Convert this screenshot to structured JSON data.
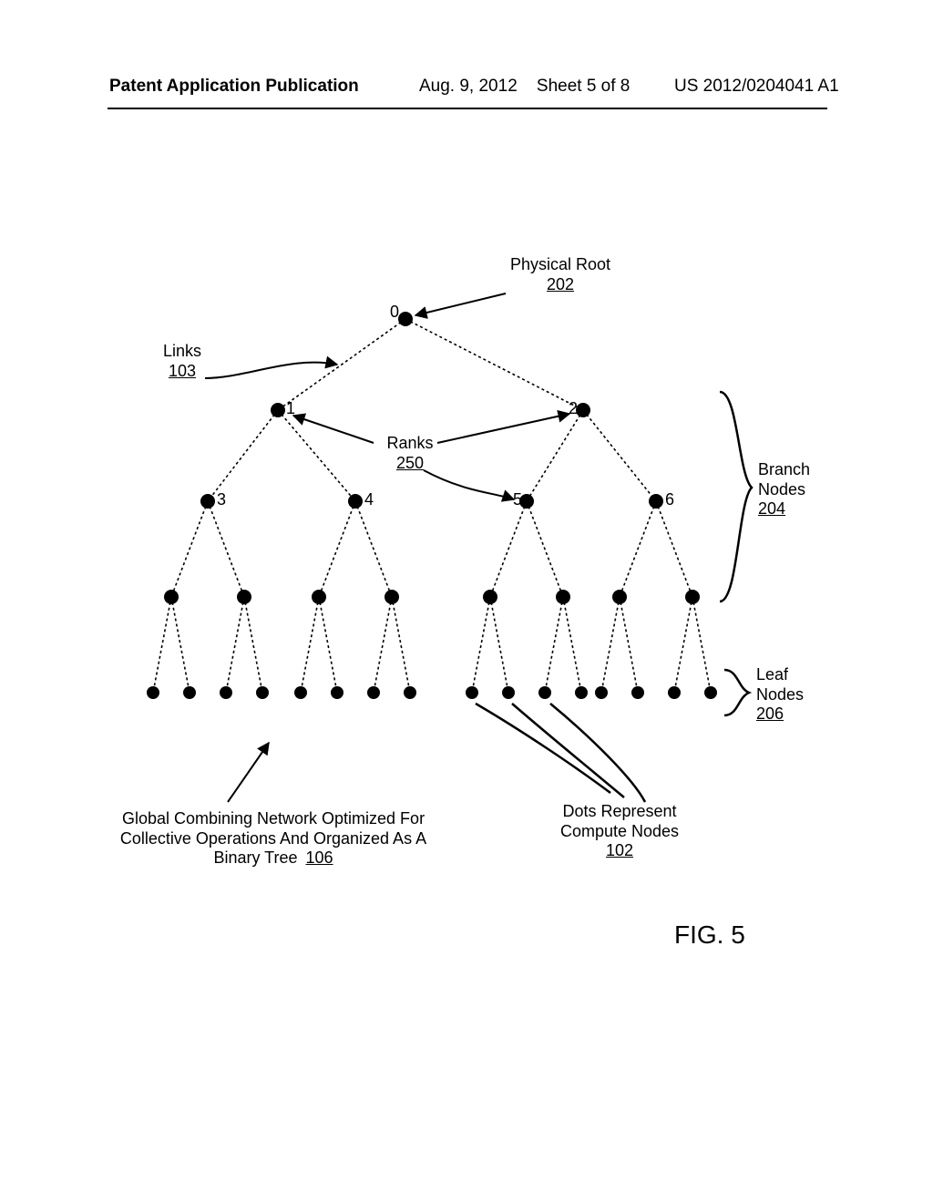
{
  "header": {
    "left": "Patent Application Publication",
    "date": "Aug. 9, 2012",
    "sheet": "Sheet 5 of 8",
    "pubnum": "US 2012/0204041 A1"
  },
  "labels": {
    "physical_root": "Physical Root",
    "physical_root_ref": "202",
    "links": "Links",
    "links_ref": "103",
    "ranks": "Ranks",
    "ranks_ref": "250",
    "branch_nodes": "Branch\nNodes",
    "branch_nodes_ref": "204",
    "leaf_nodes": "Leaf\nNodes",
    "leaf_nodes_ref": "206",
    "dots_represent": "Dots Represent\nCompute Nodes",
    "dots_represent_ref": "102",
    "global_caption": "Global Combining Network Optimized For\nCollective Operations And Organized As A\nBinary Tree",
    "global_caption_ref": "106",
    "fig": "FIG. 5"
  },
  "node_labels": {
    "n0": "0",
    "n1": "1",
    "n2": "2",
    "n3": "3",
    "n4": "4",
    "n5": "5",
    "n6": "6"
  },
  "chart_data": {
    "type": "diagram",
    "structure": "binary_tree",
    "title": "Global Combining Network Optimized For Collective Operations And Organized As A Binary Tree",
    "levels": [
      {
        "level": 0,
        "role": "Physical Root",
        "ref": "202",
        "nodes": [
          {
            "id": 0,
            "label": "0"
          }
        ]
      },
      {
        "level": 1,
        "role": "Branch Nodes",
        "ref": "204",
        "nodes": [
          {
            "id": 1,
            "label": "1"
          },
          {
            "id": 2,
            "label": "2"
          }
        ]
      },
      {
        "level": 2,
        "role": "Branch Nodes",
        "ref": "204",
        "nodes": [
          {
            "id": 3,
            "label": "3"
          },
          {
            "id": 4,
            "label": "4"
          },
          {
            "id": 5,
            "label": "5"
          },
          {
            "id": 6,
            "label": "6"
          }
        ]
      },
      {
        "level": 3,
        "role": "Branch Nodes",
        "ref": "204",
        "nodes": [
          {
            "id": 7
          },
          {
            "id": 8
          },
          {
            "id": 9
          },
          {
            "id": 10
          },
          {
            "id": 11
          },
          {
            "id": 12
          },
          {
            "id": 13
          },
          {
            "id": 14
          }
        ]
      },
      {
        "level": 4,
        "role": "Leaf Nodes",
        "ref": "206",
        "nodes": [
          {
            "id": 15
          },
          {
            "id": 16
          },
          {
            "id": 17
          },
          {
            "id": 18
          },
          {
            "id": 19
          },
          {
            "id": 20
          },
          {
            "id": 21
          },
          {
            "id": 22
          },
          {
            "id": 23
          },
          {
            "id": 24
          },
          {
            "id": 25
          },
          {
            "id": 26
          },
          {
            "id": 27
          },
          {
            "id": 28
          },
          {
            "id": 29
          },
          {
            "id": 30
          }
        ]
      }
    ],
    "edges_note": "Each node at level L has two children at level L+1 (binary tree).",
    "annotations": {
      "Links": "103",
      "Ranks": "250",
      "Dots Represent Compute Nodes": "102"
    }
  }
}
